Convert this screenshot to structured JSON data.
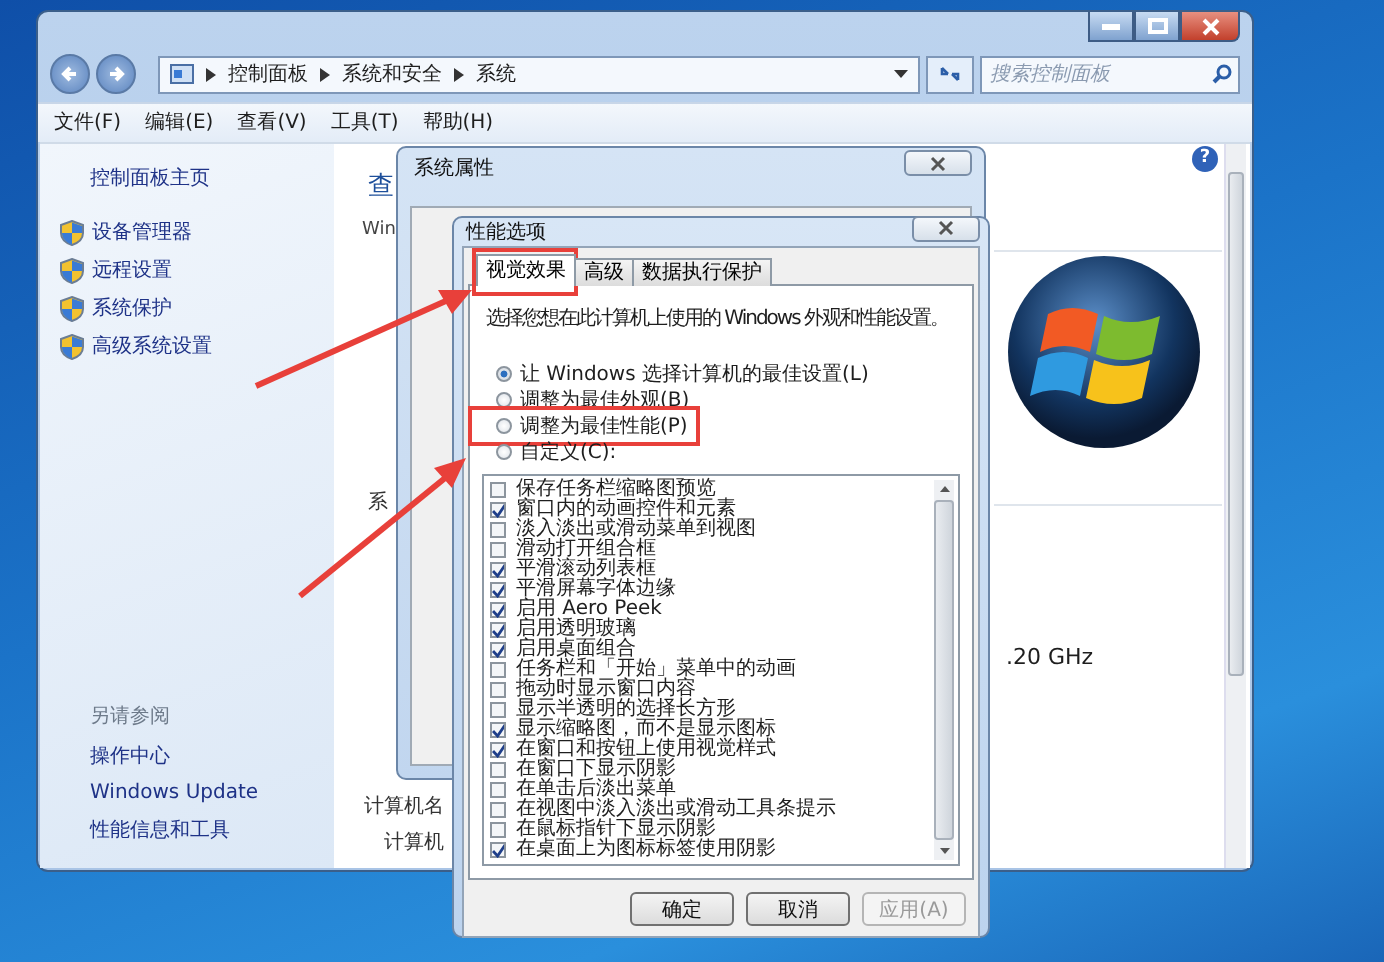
{
  "explorer": {
    "breadcrumb": [
      "控制面板",
      "系统和安全",
      "系统"
    ],
    "search": {
      "placeholder": "搜索控制面板"
    },
    "menu": [
      "文件(F)",
      "编辑(E)",
      "查看(V)",
      "工具(T)",
      "帮助(H)"
    ],
    "sidebar": {
      "home": "控制面板主页",
      "links": [
        "设备管理器",
        "远程设置",
        "系统保护",
        "高级系统设置"
      ],
      "see_also_title": "另请参阅",
      "see_also": [
        "操作中心",
        "Windows Update",
        "性能信息和工具"
      ]
    },
    "help_glyph": "?",
    "content": {
      "heading": "查",
      "line_1": "Win",
      "section": "系",
      "processor": ".20 GHz",
      "computer_name_heading": "计算机名",
      "computer_label": "计算机"
    }
  },
  "system_properties": {
    "title": "系统属性"
  },
  "performance_options": {
    "title": "性能选项",
    "tabs": [
      {
        "label": "视觉效果",
        "selected": true,
        "highlighted": true
      },
      {
        "label": "高级",
        "selected": false,
        "highlighted": false
      },
      {
        "label": "数据执行保护",
        "selected": false,
        "highlighted": false
      }
    ],
    "description": "选择您想在此计算机上使用的 Windows 外观和性能设置。",
    "options": [
      {
        "label": "让 Windows 选择计算机的最佳设置(L)",
        "selected": true,
        "highlighted": false
      },
      {
        "label": "调整为最佳外观(B)",
        "selected": false,
        "highlighted": false
      },
      {
        "label": "调整为最佳性能(P)",
        "selected": false,
        "highlighted": true
      },
      {
        "label": "自定义(C):",
        "selected": false,
        "highlighted": false
      }
    ],
    "effects": [
      {
        "label": "保存任务栏缩略图预览",
        "checked": false
      },
      {
        "label": "窗口内的动画控件和元素",
        "checked": true
      },
      {
        "label": "淡入淡出或滑动菜单到视图",
        "checked": false
      },
      {
        "label": "滑动打开组合框",
        "checked": false
      },
      {
        "label": "平滑滚动列表框",
        "checked": true
      },
      {
        "label": "平滑屏幕字体边缘",
        "checked": true
      },
      {
        "label": "启用 Aero Peek",
        "checked": true
      },
      {
        "label": "启用透明玻璃",
        "checked": true
      },
      {
        "label": "启用桌面组合",
        "checked": true
      },
      {
        "label": "任务栏和「开始」菜单中的动画",
        "checked": false
      },
      {
        "label": "拖动时显示窗口内容",
        "checked": false
      },
      {
        "label": "显示半透明的选择长方形",
        "checked": false
      },
      {
        "label": "显示缩略图，而不是显示图标",
        "checked": true
      },
      {
        "label": "在窗口和按钮上使用视觉样式",
        "checked": true
      },
      {
        "label": "在窗口下显示阴影",
        "checked": false
      },
      {
        "label": "在单击后淡出菜单",
        "checked": false
      },
      {
        "label": "在视图中淡入淡出或滑动工具条提示",
        "checked": false
      },
      {
        "label": "在鼠标指针下显示阴影",
        "checked": false
      },
      {
        "label": "在桌面上为图标标签使用阴影",
        "checked": true
      }
    ],
    "buttons": [
      {
        "label": "确定",
        "disabled": false
      },
      {
        "label": "取消",
        "disabled": false
      },
      {
        "label": "应用(A)",
        "disabled": true
      }
    ]
  }
}
